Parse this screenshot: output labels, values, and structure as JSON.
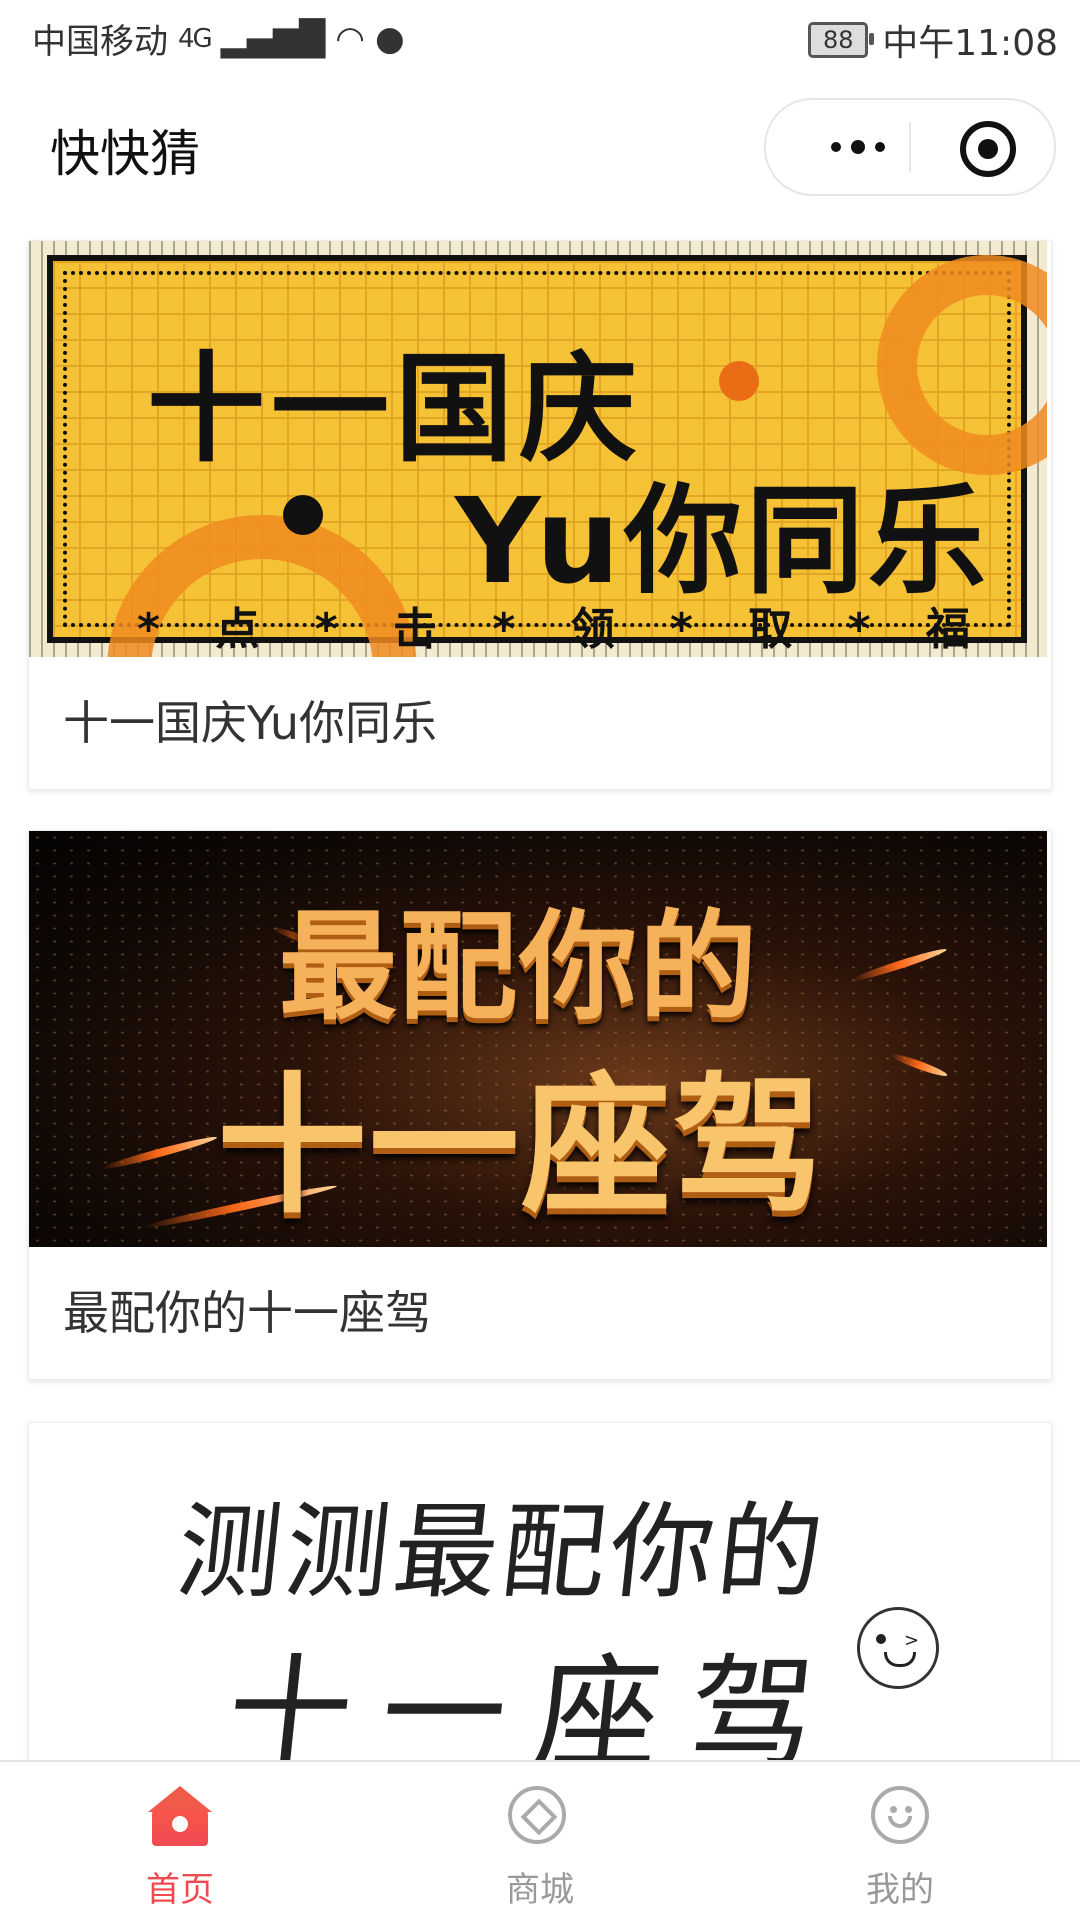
{
  "status_bar": {
    "carrier": "中国移动",
    "network": "4G",
    "battery": "88",
    "time": "中午11:08"
  },
  "header": {
    "title": "快快猜"
  },
  "cards": [
    {
      "banner_line1": "十一国庆",
      "banner_line2": "Yu你同乐",
      "banner_line3": "* 点 * 击 * 领 * 取 * 福 * 利 *",
      "caption": "十一国庆Yu你同乐"
    },
    {
      "banner_line1": "最配你的",
      "banner_line2": "十一座驾",
      "caption": "最配你的十一座驾"
    },
    {
      "banner_line1": "测测最配你的",
      "banner_line2": "十一座驾"
    }
  ],
  "tabbar": {
    "items": [
      {
        "label": "首页",
        "icon": "home-icon",
        "active": true
      },
      {
        "label": "商城",
        "icon": "mall-icon",
        "active": false
      },
      {
        "label": "我的",
        "icon": "profile-icon",
        "active": false
      }
    ],
    "active_color": "#f0494f",
    "inactive_color": "#999999"
  }
}
